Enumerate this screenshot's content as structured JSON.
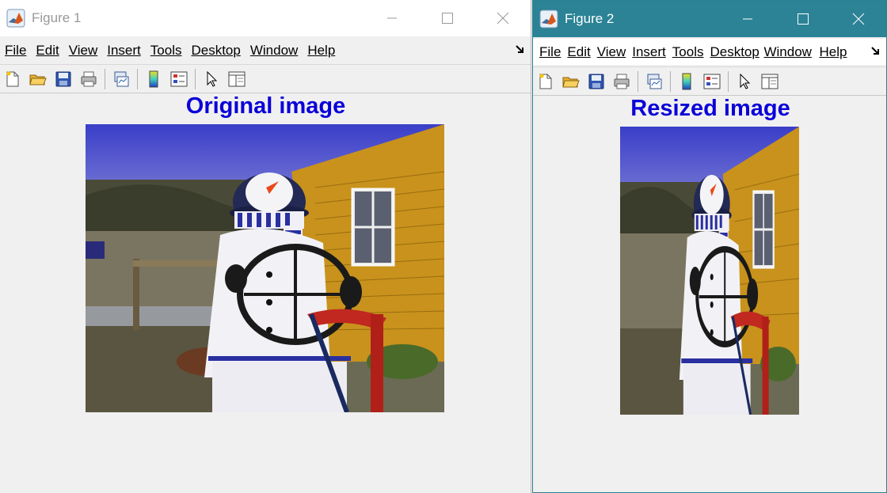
{
  "windows": [
    {
      "title": "Figure 1",
      "active": false,
      "menu": [
        "File",
        "Edit",
        "View",
        "Insert",
        "Tools",
        "Desktop",
        "Window",
        "Help"
      ],
      "axes_title": "Original image",
      "image": "snowman-photo"
    },
    {
      "title": "Figure 2",
      "active": true,
      "menu": [
        "File",
        "Edit",
        "View",
        "Insert",
        "Tools",
        "Desktop",
        "Window",
        "Help"
      ],
      "axes_title": "Resized image",
      "image": "snowman-photo-resized"
    }
  ],
  "toolbar_icons": [
    "new-figure-icon",
    "open-file-icon",
    "save-icon",
    "print-icon",
    "link-plot-icon",
    "colorbar-icon",
    "legend-icon",
    "pointer-icon",
    "property-inspector-icon"
  ],
  "colors": {
    "active_titlebar": "#2b8395",
    "axes_title": "#0a00d8"
  }
}
